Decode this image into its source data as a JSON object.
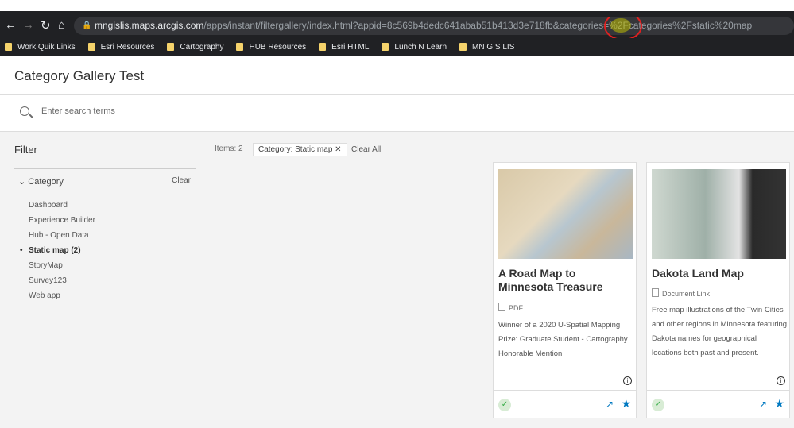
{
  "browser": {
    "url_host": "mngislis.maps.arcgis.com",
    "url_path": "/apps/instant/filtergallery/index.html?appid=8c569b4dedc641abab51b413d3e718fb&categories=%2Fcategories%2Fstatic%20map",
    "bookmarks": [
      "Work Quik Links",
      "Esri Resources",
      "Cartography",
      "HUB Resources",
      "Esri HTML",
      "Lunch N Learn",
      "MN GIS LIS"
    ]
  },
  "header": {
    "title": "Category Gallery Test"
  },
  "search": {
    "placeholder": "Enter search terms"
  },
  "filter": {
    "title": "Filter",
    "category_label": "Category",
    "clear_label": "Clear",
    "items": [
      "Dashboard",
      "Experience Builder",
      "Hub - Open Data",
      "Static map (2)",
      "StoryMap",
      "Survey123",
      "Web app"
    ],
    "selected": "Static map (2)"
  },
  "results": {
    "count_label": "Items: 2",
    "chip_label": "Category: Static map",
    "clear_all": "Clear All"
  },
  "cards": [
    {
      "title": "A Road Map to Minnesota Treasure",
      "type": "PDF",
      "description": "Winner of a 2020 U-Spatial Mapping Prize: Graduate Student - Cartography Honorable Mention"
    },
    {
      "title": "Dakota Land Map",
      "type": "Document Link",
      "description": "Free map illustrations of the Twin Cities and other regions in Minnesota featuring Dakota names for geographical locations both past and present."
    }
  ],
  "colors": {
    "accent": "#0079c1",
    "status": "#35ac46"
  }
}
